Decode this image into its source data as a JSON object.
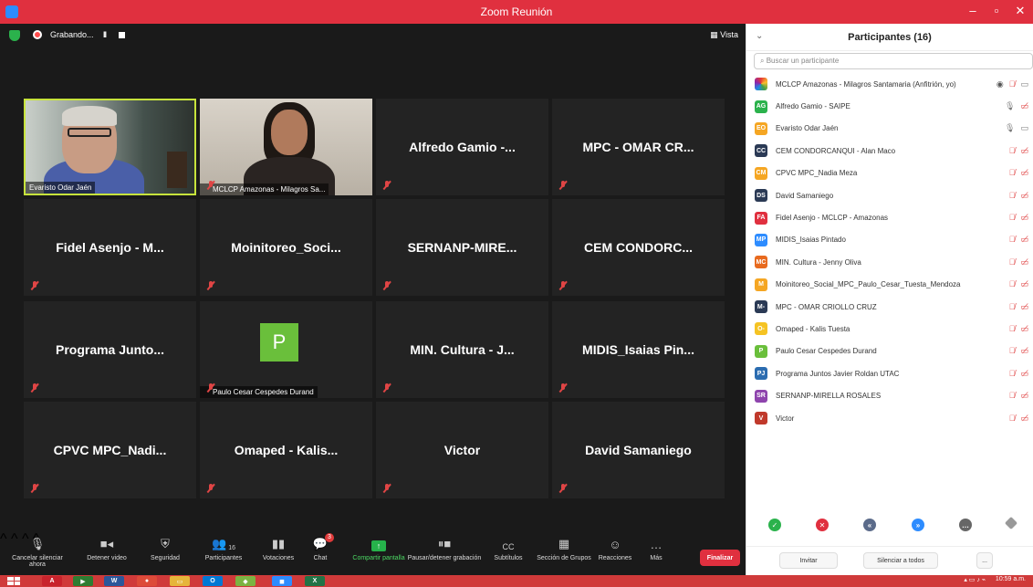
{
  "window": {
    "title": "Zoom Reunión"
  },
  "meeting_top": {
    "recording": "Grabando...",
    "pause": "II",
    "view": "Vista"
  },
  "tiles": [
    {
      "name": "",
      "caption": "Evaristo Odar Jaén",
      "type": "video1"
    },
    {
      "name": "",
      "caption": "MCLCP Amazonas - Milagros Sa...",
      "type": "video2"
    },
    {
      "name": "Alfredo Gamio -...",
      "caption": ""
    },
    {
      "name": "MPC - OMAR CR...",
      "caption": ""
    },
    {
      "name": "Fidel Asenjo - M...",
      "caption": ""
    },
    {
      "name": "Moinitoreo_Soci...",
      "caption": ""
    },
    {
      "name": "SERNANP-MIRE...",
      "caption": ""
    },
    {
      "name": "CEM CONDORC...",
      "caption": ""
    },
    {
      "name": "Programa Junto...",
      "caption": ""
    },
    {
      "name": "",
      "caption": "Paulo Cesar Cespedes Durand",
      "type": "avatar",
      "avatar_letter": "P"
    },
    {
      "name": "MIN. Cultura - J...",
      "caption": ""
    },
    {
      "name": "MIDIS_Isaias Pin...",
      "caption": ""
    },
    {
      "name": "CPVC MPC_Nadi...",
      "caption": ""
    },
    {
      "name": "Omaped  - Kalis...",
      "caption": ""
    },
    {
      "name": "Victor",
      "caption": ""
    },
    {
      "name": "David Samaniego",
      "caption": ""
    }
  ],
  "toolbar": {
    "mute": "Cancelar silenciar ahora",
    "video": "Detener video",
    "security": "Seguridad",
    "participants": "Participantes",
    "participants_count": "16",
    "polls": "Votaciones",
    "chat": "Chat",
    "chat_badge": "3",
    "share": "Compartir pantalla",
    "record": "Pausar/detener grabación",
    "subtitles": "Subtítulos",
    "breakout": "Sección de Grupos",
    "reactions": "Reacciones",
    "more": "Más",
    "end": "Finalizar"
  },
  "panel": {
    "title": "Participantes (16)",
    "search_placeholder": "Buscar un participante",
    "participants": [
      {
        "initials": "",
        "name": "MCLCP Amazonas - Milagros Santamaria (Anfitrión, yo)",
        "color": "rainbow",
        "mic": "muted",
        "cam": "on"
      },
      {
        "initials": "AG",
        "name": "Alfredo Gamio - SAIPE",
        "color": "#2bb24c",
        "mic": "on",
        "cam": "off"
      },
      {
        "initials": "EO",
        "name": "Evaristo Odar Jaén",
        "color": "#f5a623",
        "mic": "on",
        "cam": "on"
      },
      {
        "initials": "CC",
        "name": "CEM CONDORCANQUI - Alan Maco",
        "color": "#2b3a55",
        "mic": "muted",
        "cam": "off"
      },
      {
        "initials": "CM",
        "name": "CPVC MPC_Nadia Meza",
        "color": "#f5a623",
        "mic": "muted",
        "cam": "off"
      },
      {
        "initials": "DS",
        "name": "David Samaniego",
        "color": "#2b3a55",
        "mic": "muted",
        "cam": "off"
      },
      {
        "initials": "FA",
        "name": "Fidel Asenjo - MCLCP - Amazonas",
        "color": "#e0303f",
        "mic": "muted",
        "cam": "off"
      },
      {
        "initials": "MP",
        "name": "MIDIS_Isaias Pintado",
        "color": "#2d8cff",
        "mic": "muted",
        "cam": "off"
      },
      {
        "initials": "MC",
        "name": "MIN. Cultura - Jenny Oliva",
        "color": "#e86a1e",
        "mic": "muted",
        "cam": "off"
      },
      {
        "initials": "M",
        "name": "Moinitoreo_Social_MPC_Paulo_Cesar_Tuesta_Mendoza",
        "color": "#f5a623",
        "mic": "muted",
        "cam": "off"
      },
      {
        "initials": "M-",
        "name": "MPC - OMAR CRIOLLO CRUZ",
        "color": "#2b3a55",
        "mic": "muted",
        "cam": "off"
      },
      {
        "initials": "O-",
        "name": "Omaped  - Kalis Tuesta",
        "color": "#f5c323",
        "mic": "muted",
        "cam": "off"
      },
      {
        "initials": "P",
        "name": "Paulo Cesar Cespedes Durand",
        "color": "#6abf3b",
        "mic": "muted",
        "cam": "off"
      },
      {
        "initials": "PJ",
        "name": "Programa Juntos Javier Roldan UTAC",
        "color": "#2b6cb0",
        "mic": "muted",
        "cam": "off"
      },
      {
        "initials": "SR",
        "name": "SERNANP-MIRELLA ROSALES",
        "color": "#8e44ad",
        "mic": "muted",
        "cam": "off"
      },
      {
        "initials": "V",
        "name": "Victor",
        "color": "#c0392b",
        "mic": "muted",
        "cam": "off"
      }
    ],
    "invite": "Invitar",
    "mute_all": "Silenciar a todos",
    "more": "..."
  },
  "taskbar": {
    "time": "10:59 a.m."
  },
  "colors": {
    "accent_red": "#e0303f",
    "green": "#2bb24c",
    "blue": "#2d8cff"
  }
}
